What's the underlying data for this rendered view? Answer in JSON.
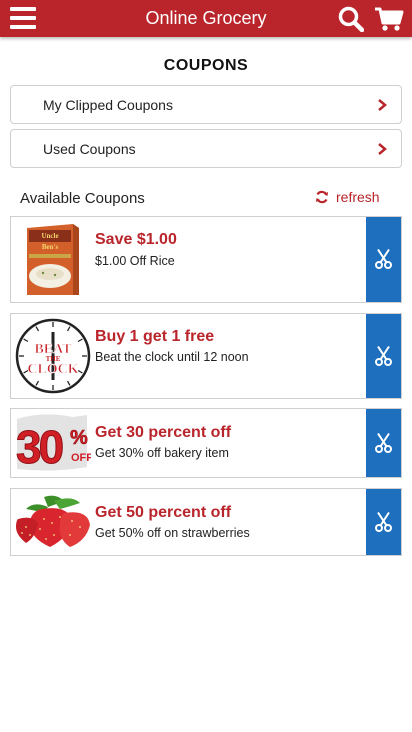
{
  "header": {
    "title": "Online Grocery",
    "menu_icon": "hamburger-menu-icon",
    "search_icon": "search-icon",
    "cart_icon": "shopping-cart-icon",
    "color": "#b9252b"
  },
  "page": {
    "title": "COUPONS"
  },
  "nav": [
    {
      "label": "My Clipped Coupons"
    },
    {
      "label": "Used Coupons"
    }
  ],
  "available": {
    "label": "Available Coupons",
    "refresh_label": "refresh"
  },
  "coupons": [
    {
      "title": "Save $1.00",
      "description": "$1.00 Off Rice",
      "image": "rice-box",
      "image_text_1": "Uncle",
      "image_text_2": "Ben's"
    },
    {
      "title": "Buy 1 get 1 free",
      "description": "Beat the clock until 12 noon",
      "image": "clock",
      "image_text_1": "BEAT",
      "image_text_2": "THE",
      "image_text_3": "CLOCK"
    },
    {
      "title": "Get 30 percent off",
      "description": "Get 30% off bakery item",
      "image": "percent-badge",
      "image_text_1": "30",
      "image_text_2": "%",
      "image_text_3": "OFF"
    },
    {
      "title": "Get 50 percent off",
      "description": "Get 50% off on strawberries",
      "image": "strawberries"
    }
  ],
  "colors": {
    "accent": "#b9252b",
    "clip_button": "#1e6fbe"
  }
}
